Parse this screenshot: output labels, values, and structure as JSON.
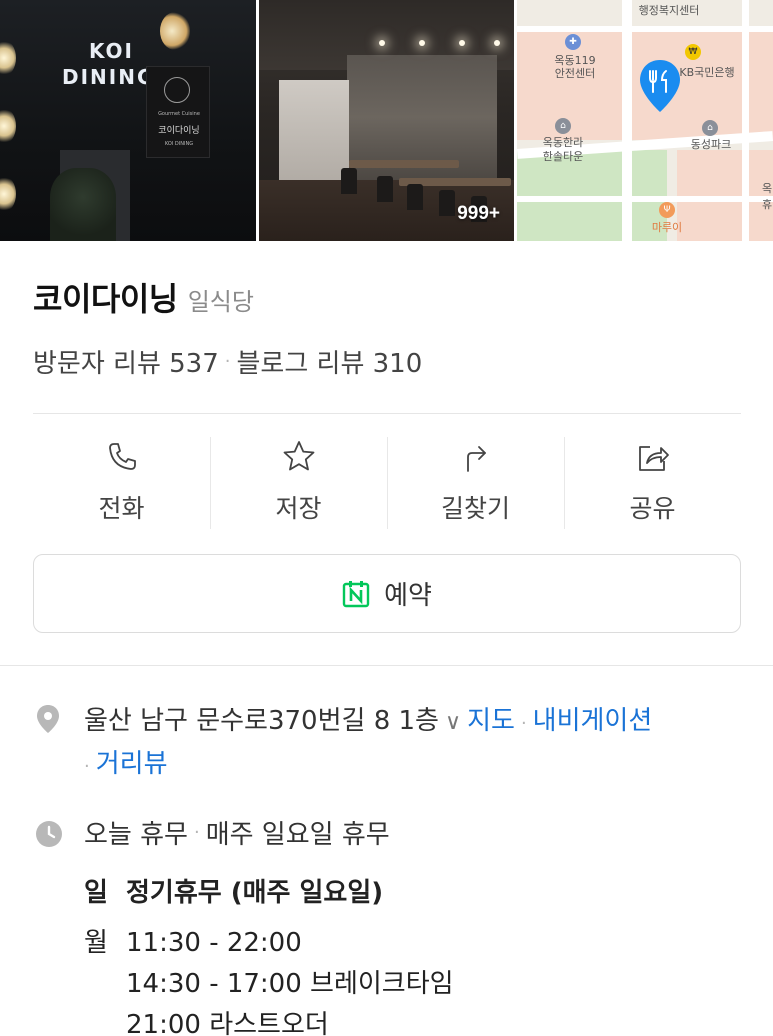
{
  "photos": {
    "photo1": {
      "sign_line1": "KOI",
      "sign_line2": "DINING",
      "board_sub": "Gourmet Cuisine",
      "board_name": "코이다이닝",
      "board_foot": "KOI DINING"
    },
    "photo2": {
      "count": "999+"
    },
    "map": {
      "labels": [
        "행정복지센터",
        "옥동119",
        "안전센터",
        "KB국민은행",
        "옥동한라",
        "한솔타운",
        "동성파크",
        "마루이",
        "옥",
        "휴"
      ]
    }
  },
  "place": {
    "name": "코이다이닝",
    "category": "일식당",
    "visitor_reviews_label": "방문자 리뷰 537",
    "blog_reviews_label": "블로그 리뷰 310"
  },
  "actions": [
    {
      "label": "전화",
      "icon": "phone-icon"
    },
    {
      "label": "저장",
      "icon": "star-icon"
    },
    {
      "label": "길찾기",
      "icon": "directions-icon"
    },
    {
      "label": "공유",
      "icon": "share-icon"
    }
  ],
  "reserve": {
    "label": "예약",
    "icon": "naver-calendar-icon",
    "brand_color": "#03c75a"
  },
  "address": {
    "text": "울산 남구 문수로370번길 8 1층",
    "chevron": "∨",
    "links": [
      "지도",
      "내비게이션",
      "거리뷰"
    ],
    "link_color": "#1a73d6"
  },
  "hours": {
    "today_status": "오늘 휴무",
    "today_detail": "매주 일요일 휴무",
    "rows": [
      {
        "day": "일",
        "text": "정기휴무 (매주 일요일)"
      },
      {
        "day": "월",
        "text": "11:30 - 22:00"
      }
    ],
    "extra_lines": [
      "14:30 - 17:00 브레이크타임",
      "21:00 라스트오더"
    ]
  }
}
